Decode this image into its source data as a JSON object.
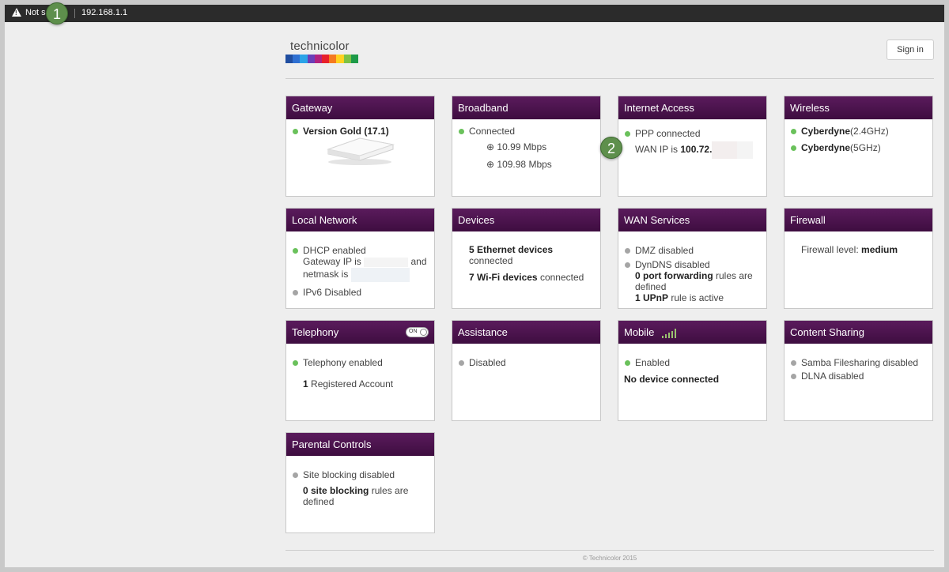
{
  "browser": {
    "security": "Not s",
    "url": "192.168.1.1"
  },
  "badges": {
    "b1": "1",
    "b2": "2"
  },
  "brand": {
    "name": "technicolor",
    "colors": [
      "#1f4da0",
      "#2e6fd1",
      "#2aa3e8",
      "#6a3fb8",
      "#b1227f",
      "#e8202a",
      "#f57a1f",
      "#ffd21f",
      "#7cc244",
      "#1d9a48"
    ]
  },
  "signin": "Sign in",
  "cards": {
    "gateway": {
      "title": "Gateway",
      "version": "Version Gold (17.1)"
    },
    "broadband": {
      "title": "Broadband",
      "status": "Connected",
      "down": "10.99 Mbps",
      "up": "109.98 Mbps"
    },
    "internet": {
      "title": "Internet Access",
      "status": "PPP connected",
      "wan_prefix": "WAN IP is",
      "wan_ip": "100.72."
    },
    "wireless": {
      "title": "Wireless",
      "ssid1": "Cyberdyne",
      "band1": "(2.4GHz)",
      "ssid2": "Cyberdyne",
      "band2": "(5GHz)"
    },
    "local": {
      "title": "Local Network",
      "dhcp": "DHCP enabled",
      "gw_prefix": "Gateway IP is",
      "and": "and",
      "netmask": "netmask is",
      "ipv6": "IPv6 Disabled"
    },
    "devices": {
      "title": "Devices",
      "eth_count": "5 Ethernet devices",
      "eth_suffix": "connected",
      "wifi_count": "7 Wi-Fi devices",
      "wifi_suffix": "connected"
    },
    "wan": {
      "title": "WAN Services",
      "dmz": "DMZ disabled",
      "dyndns": "DynDNS disabled",
      "pf_bold": "0 port forwarding",
      "pf_rest": "rules are defined",
      "upnp_bold": "1 UPnP",
      "upnp_rest": "rule is active"
    },
    "firewall": {
      "title": "Firewall",
      "label": "Firewall level:",
      "level": "medium"
    },
    "telephony": {
      "title": "Telephony",
      "toggle": "ON",
      "status": "Telephony enabled",
      "count": "1",
      "accounts": "Registered Account"
    },
    "assistance": {
      "title": "Assistance",
      "status": "Disabled"
    },
    "mobile": {
      "title": "Mobile",
      "status": "Enabled",
      "device": "No device connected"
    },
    "content": {
      "title": "Content Sharing",
      "samba": "Samba Filesharing disabled",
      "dlna": "DLNA disabled"
    },
    "parental": {
      "title": "Parental Controls",
      "site": "Site blocking disabled",
      "rules_bold": "0 site blocking",
      "rules_rest": "rules are defined"
    }
  },
  "footer": "© Technicolor 2015"
}
